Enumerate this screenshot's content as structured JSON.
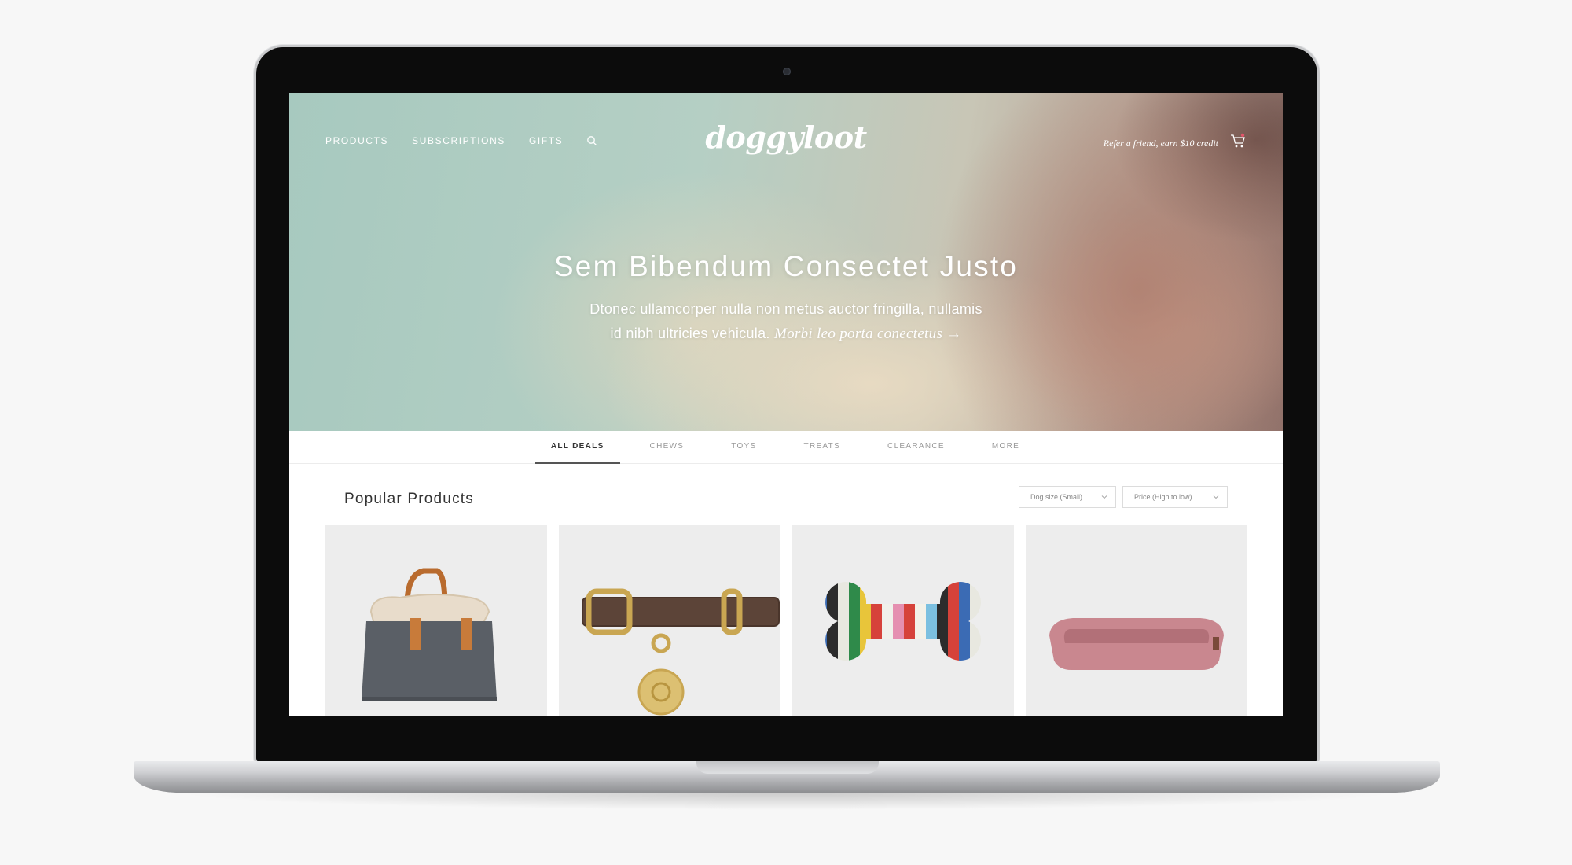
{
  "header": {
    "nav": [
      "PRODUCTS",
      "SUBSCRIPTIONS",
      "GIFTS"
    ],
    "logo": "doggyloot",
    "refer": "Refer a friend, earn $10 credit"
  },
  "hero": {
    "title": "Sem Bibendum Consectet Justo",
    "subtitle_line1": "Dtonec ullamcorper nulla non metus auctor fringilla, nullamis",
    "subtitle_line2": "id nibh ultricies vehicula.",
    "link": "Morbi leo porta conectetus →"
  },
  "tabs": [
    "ALL DEALS",
    "CHEWS",
    "TOYS",
    "TREATS",
    "CLEARANCE",
    "MORE"
  ],
  "main": {
    "section_title": "Popular Products",
    "filters": {
      "dog_size": "Dog size (Small)",
      "price": "Price (High to low)"
    },
    "products": [
      {
        "icon": "dog-carrier-bag"
      },
      {
        "icon": "leather-collar"
      },
      {
        "icon": "striped-bone-toy"
      },
      {
        "icon": "pink-dog-bed"
      }
    ]
  },
  "colors": {
    "accent": "#555555",
    "hero_teal": "#a7c9bf"
  }
}
